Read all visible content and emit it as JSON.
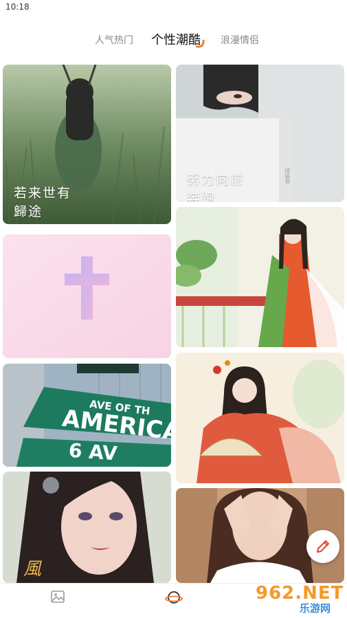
{
  "status_bar": {
    "time": "10:18"
  },
  "tabs": [
    {
      "label": "人气热门",
      "active": false
    },
    {
      "label": "个性潮酷",
      "active": true
    },
    {
      "label": "浪漫情侣",
      "active": false
    }
  ],
  "cards": [
    {
      "caption": "若来世有\n歸途",
      "icon": "photo-girl-grass"
    },
    {
      "caption": "努力向前\n奔跑",
      "icon": "photo-girl-book"
    },
    {
      "caption": "",
      "icon": "pink-cross-image"
    },
    {
      "caption": "",
      "icon": "photo-hanfu-garden"
    },
    {
      "caption": "",
      "icon": "photo-street-sign"
    },
    {
      "caption": "",
      "icon": "photo-hanfu-fan"
    },
    {
      "caption": "",
      "icon": "photo-game-character"
    },
    {
      "caption": "",
      "icon": "photo-girl-hands"
    }
  ],
  "street_sign": {
    "line1": "AVE OF TH",
    "line2": "AMERICA",
    "line3": "6 AV"
  },
  "bottom_nav": [
    {
      "icon": "gallery-icon",
      "active": false
    },
    {
      "icon": "planet-icon",
      "active": true,
      "accent": "#f07a2e"
    }
  ],
  "fab": {
    "icon": "pencil-icon"
  },
  "watermark": {
    "main": "962.NET",
    "sub": "乐游网"
  }
}
